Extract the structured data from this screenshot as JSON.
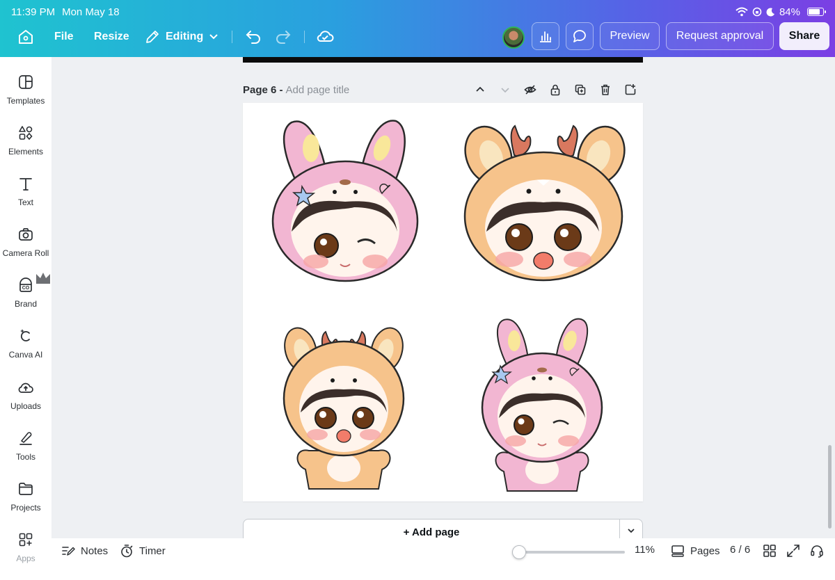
{
  "status_bar": {
    "time": "11:39 PM",
    "date": "Mon May 18",
    "battery": "84%",
    "battery_level": 0.84
  },
  "toolbar": {
    "file_label": "File",
    "resize_label": "Resize",
    "editing_label": "Editing",
    "preview_label": "Preview",
    "request_approval_label": "Request approval",
    "share_label": "Share"
  },
  "sidebar": {
    "items": [
      {
        "label": "Templates",
        "icon": "templates-icon"
      },
      {
        "label": "Elements",
        "icon": "elements-icon"
      },
      {
        "label": "Text",
        "icon": "text-icon"
      },
      {
        "label": "Camera Roll",
        "icon": "camera-icon"
      },
      {
        "label": "Brand",
        "icon": "brand-icon"
      },
      {
        "label": "Canva AI",
        "icon": "canva-ai-icon"
      },
      {
        "label": "Uploads",
        "icon": "upload-icon"
      },
      {
        "label": "Tools",
        "icon": "tools-icon"
      },
      {
        "label": "Projects",
        "icon": "folder-icon"
      },
      {
        "label": "Apps",
        "icon": "apps-icon"
      }
    ]
  },
  "page": {
    "label": "Page 6 -",
    "title_placeholder": "Add page title"
  },
  "add_page_label": "+ Add page",
  "bottom_bar": {
    "notes_label": "Notes",
    "timer_label": "Timer",
    "zoom": "11%",
    "zoom_slider_value": 0.05,
    "pages_label": "Pages",
    "page_count": "6 / 6"
  },
  "colors": {
    "accent_pink": "#f2b6d2",
    "accent_orange": "#f6c38b",
    "share_bg": "#f2eefc"
  }
}
